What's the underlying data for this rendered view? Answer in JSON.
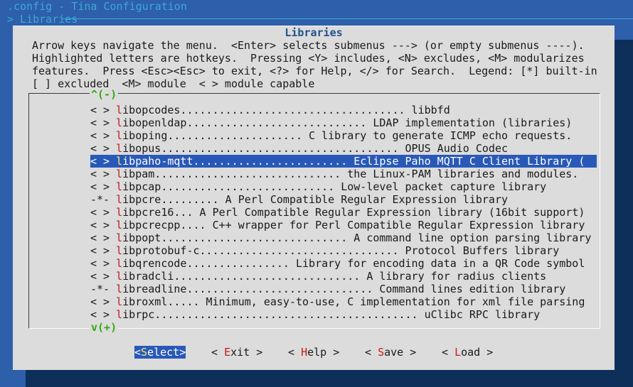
{
  "window": {
    "breadcrumb_path": ".config - Tina Configuration",
    "breadcrumb_section": "> Libraries"
  },
  "dialog": {
    "title": "Libraries",
    "help_lines": [
      "Arrow keys navigate the menu.  <Enter> selects submenus ---> (or empty submenus ----).",
      "Highlighted letters are hotkeys.  Pressing <Y> includes, <N> excludes, <M> modularizes",
      "features.  Press <Esc><Esc> to exit, <?> for Help, </> for Search.  Legend: [*] built-in",
      "[ ] excluded  <M> module  < > module capable"
    ],
    "scroll_up": "^(-)",
    "scroll_down": "v(+)"
  },
  "menu": {
    "items": [
      {
        "state": "< >",
        "hotkey": "l",
        "rest": "ibopcodes................................... libbfd"
      },
      {
        "state": "< >",
        "hotkey": "l",
        "rest": "ibopenldap............................ LDAP implementation (libraries)"
      },
      {
        "state": "< >",
        "hotkey": "l",
        "rest": "iboping..................... C library to generate ICMP echo requests."
      },
      {
        "state": "< >",
        "hotkey": "l",
        "rest": "ibopus..................................... OPUS Audio Codec"
      },
      {
        "state": "< >",
        "hotkey": "l",
        "rest": "ibpaho-mqtt........................ Eclipse Paho MQTT C Client Library (",
        "selected": true
      },
      {
        "state": "< >",
        "hotkey": "l",
        "rest": "ibpam............................. the Linux-PAM libraries and modules."
      },
      {
        "state": "< >",
        "hotkey": "l",
        "rest": "ibpcap........................... Low-level packet capture library"
      },
      {
        "state": "-*-",
        "hotkey": "l",
        "rest": "ibpcre......... A Perl Compatible Regular Expression library"
      },
      {
        "state": "< >",
        "hotkey": "l",
        "rest": "ibpcre16... A Perl Compatible Regular Expression library (16bit support)"
      },
      {
        "state": "< >",
        "hotkey": "l",
        "rest": "ibpcrecpp.... C++ wrapper for Perl Compatible Regular Expression library"
      },
      {
        "state": "< >",
        "hotkey": "l",
        "rest": "ibpopt............................. A command line option parsing library"
      },
      {
        "state": "< >",
        "hotkey": "l",
        "rest": "ibprotobuf-c............................... Protocol Buffers library"
      },
      {
        "state": "< >",
        "hotkey": "l",
        "rest": "ibqrencode................ Library for encoding data in a QR Code symbol"
      },
      {
        "state": "< >",
        "hotkey": "l",
        "rest": "ibradcli............................. A library for radius clients"
      },
      {
        "state": "-*-",
        "hotkey": "l",
        "rest": "ibreadline............................. Command lines edition library"
      },
      {
        "state": "< >",
        "hotkey": "l",
        "rest": "ibroxml..... Minimum, easy-to-use, C implementation for xml file parsing"
      },
      {
        "state": "< >",
        "hotkey": "l",
        "rest": "ibrpc......................................... uClibc RPC library"
      }
    ]
  },
  "buttons": {
    "select": {
      "pre": "<",
      "hotkey": "S",
      "post": "elect>"
    },
    "exit": {
      "pre": "< ",
      "hotkey": "E",
      "post": "xit >"
    },
    "help": {
      "pre": "< ",
      "hotkey": "H",
      "post": "elp >"
    },
    "save": {
      "pre": "< ",
      "hotkey": "S",
      "post": "ave >"
    },
    "load": {
      "pre": "< ",
      "hotkey": "L",
      "post": "oad >"
    }
  }
}
